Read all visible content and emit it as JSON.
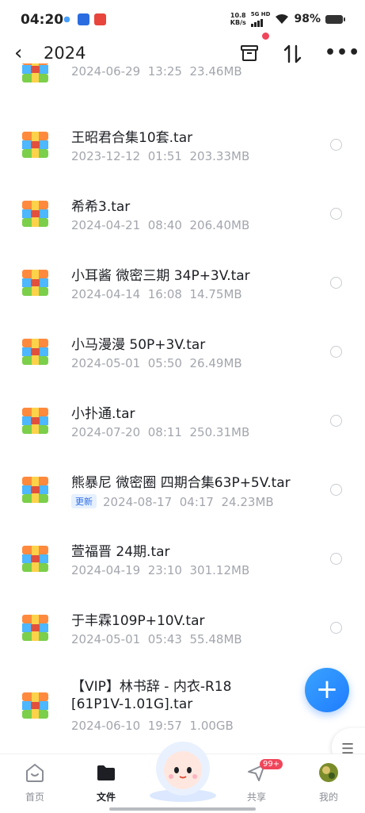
{
  "status_bar": {
    "time": "04:20",
    "net_speed_value": "10.8",
    "net_speed_unit": "KB/s",
    "signal_label": "5G HD",
    "battery": "98%"
  },
  "header": {
    "title": "2024"
  },
  "files": [
    {
      "name": "",
      "date": "2024-06-29",
      "time": "13:25",
      "size": "23.46MB"
    },
    {
      "name": "王昭君合集10套.tar",
      "date": "2023-12-12",
      "time": "01:51",
      "size": "203.33MB"
    },
    {
      "name": "希希3.tar",
      "date": "2024-04-21",
      "time": "08:40",
      "size": "206.40MB"
    },
    {
      "name": "小耳酱 微密三期 34P+3V.tar",
      "date": "2024-04-14",
      "time": "16:08",
      "size": "14.75MB"
    },
    {
      "name": "小马漫漫  50P+3V.tar",
      "date": "2024-05-01",
      "time": "05:50",
      "size": "26.49MB"
    },
    {
      "name": "小扑通.tar",
      "date": "2024-07-20",
      "time": "08:11",
      "size": "250.31MB"
    },
    {
      "name": "熊暴尼 微密圈 四期合集63P+5V.tar",
      "badge": "更新",
      "date": "2024-08-17",
      "time": "04:17",
      "size": "24.23MB"
    },
    {
      "name": "萱福晋  24期.tar",
      "date": "2024-04-19",
      "time": "23:10",
      "size": "301.12MB"
    },
    {
      "name": "于丰霖109P+10V.tar",
      "date": "2024-05-01",
      "time": "05:43",
      "size": "55.48MB"
    },
    {
      "name": "【VIP】林书辞 - 内衣-R18 [61P1V-1.01G].tar",
      "date": "2024-06-10",
      "time": "19:57",
      "size": "1.00GB"
    }
  ],
  "nav": {
    "home": "首页",
    "files": "文件",
    "share": "共享",
    "share_badge": "99+",
    "mine": "我的"
  },
  "colors": {
    "accent": "#1f7cff",
    "badge_red": "#f0455a"
  }
}
